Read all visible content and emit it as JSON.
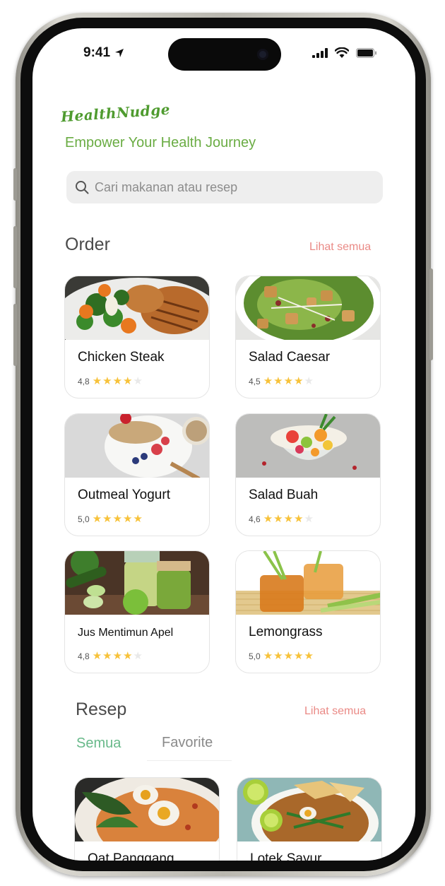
{
  "status_bar": {
    "time": "9:41"
  },
  "app": {
    "logo_text": "HealthNudge",
    "tagline": "Empower Your Health Journey"
  },
  "search": {
    "placeholder": "Cari makanan atau resep",
    "value": ""
  },
  "order": {
    "title": "Order",
    "see_all": "Lihat semua",
    "items": [
      {
        "name": "Chicken Steak",
        "rating": "4,8",
        "stars": 4
      },
      {
        "name": "Salad Caesar",
        "rating": "4,5",
        "stars": 4
      },
      {
        "name": "Outmeal Yogurt",
        "rating": "5,0",
        "stars": 5
      },
      {
        "name": "Salad Buah",
        "rating": "4,6",
        "stars": 4
      },
      {
        "name": "Jus Mentimun Apel",
        "rating": "4,8",
        "stars": 4
      },
      {
        "name": "Lemongrass",
        "rating": "5,0",
        "stars": 5
      }
    ]
  },
  "recipes": {
    "title": "Resep",
    "see_all": "Lihat semua",
    "tabs": [
      {
        "label": "Semua",
        "active": true
      },
      {
        "label": "Favorite",
        "active": false
      }
    ],
    "items": [
      {
        "name": "Oat Panggang"
      },
      {
        "name": "Lotek Sayur"
      }
    ]
  },
  "colors": {
    "brand_green": "#6aac43",
    "accent_pink": "#ea8a86",
    "tab_active": "#68b98a",
    "star": "#f7c23a"
  }
}
